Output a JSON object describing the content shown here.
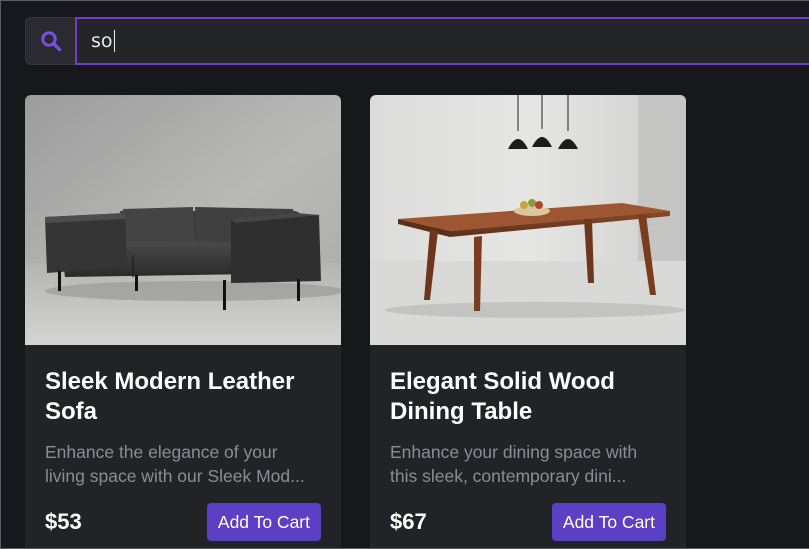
{
  "search": {
    "value": "so"
  },
  "products": [
    {
      "name": "Sleek Modern Leather Sofa",
      "description": "Enhance the elegance of your living space with our Sleek Mod...",
      "price": "$53",
      "cart_label": "Add To Cart",
      "image_icon": "leather-sofa-photo"
    },
    {
      "name": "Elegant Solid Wood Dining Table",
      "description": "Enhance your dining space with this sleek, contemporary dini...",
      "price": "$67",
      "cart_label": "Add To Cart",
      "image_icon": "dining-table-photo"
    }
  ],
  "colors": {
    "accent": "#5b3fc4",
    "focus_border": "#6c3fd1",
    "background": "#17181b",
    "card": "#222327"
  }
}
